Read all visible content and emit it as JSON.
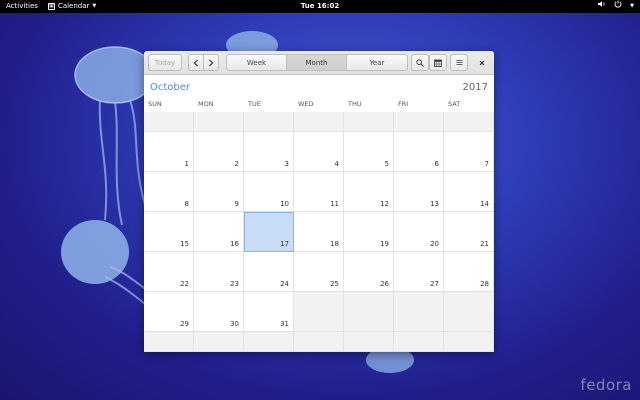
{
  "topbar": {
    "activities": "Activities",
    "app_menu": "Calendar",
    "clock": "Tue 16:02"
  },
  "toolbar": {
    "today": "Today",
    "prev_icon": "chevron-left-icon",
    "next_icon": "chevron-right-icon",
    "views": [
      "Week",
      "Month",
      "Year"
    ],
    "active_view": "Month",
    "search_icon": "search-icon",
    "calendar_icon": "calendar-list-icon",
    "menu_icon": "hamburger-icon",
    "close_icon": "close-icon"
  },
  "calendar": {
    "month": "October",
    "year": "2017",
    "weekdays": [
      "SUN",
      "MON",
      "TUE",
      "WED",
      "THU",
      "FRI",
      "SAT"
    ],
    "weeks": [
      [
        "",
        "",
        "",
        "",
        "",
        "",
        ""
      ],
      [
        "1",
        "2",
        "3",
        "4",
        "5",
        "6",
        "7"
      ],
      [
        "8",
        "9",
        "10",
        "11",
        "12",
        "13",
        "14"
      ],
      [
        "15",
        "16",
        "17",
        "18",
        "19",
        "20",
        "21"
      ],
      [
        "22",
        "23",
        "24",
        "25",
        "26",
        "27",
        "28"
      ],
      [
        "29",
        "30",
        "31",
        "",
        "",
        "",
        ""
      ],
      [
        "",
        "",
        "",
        "",
        "",
        "",
        ""
      ]
    ],
    "today": "17"
  },
  "branding": {
    "watermark": "fedora"
  },
  "colors": {
    "accent": "#4a90d9",
    "today_bg": "#c9dcf6",
    "desktop": "#2f3db7"
  }
}
